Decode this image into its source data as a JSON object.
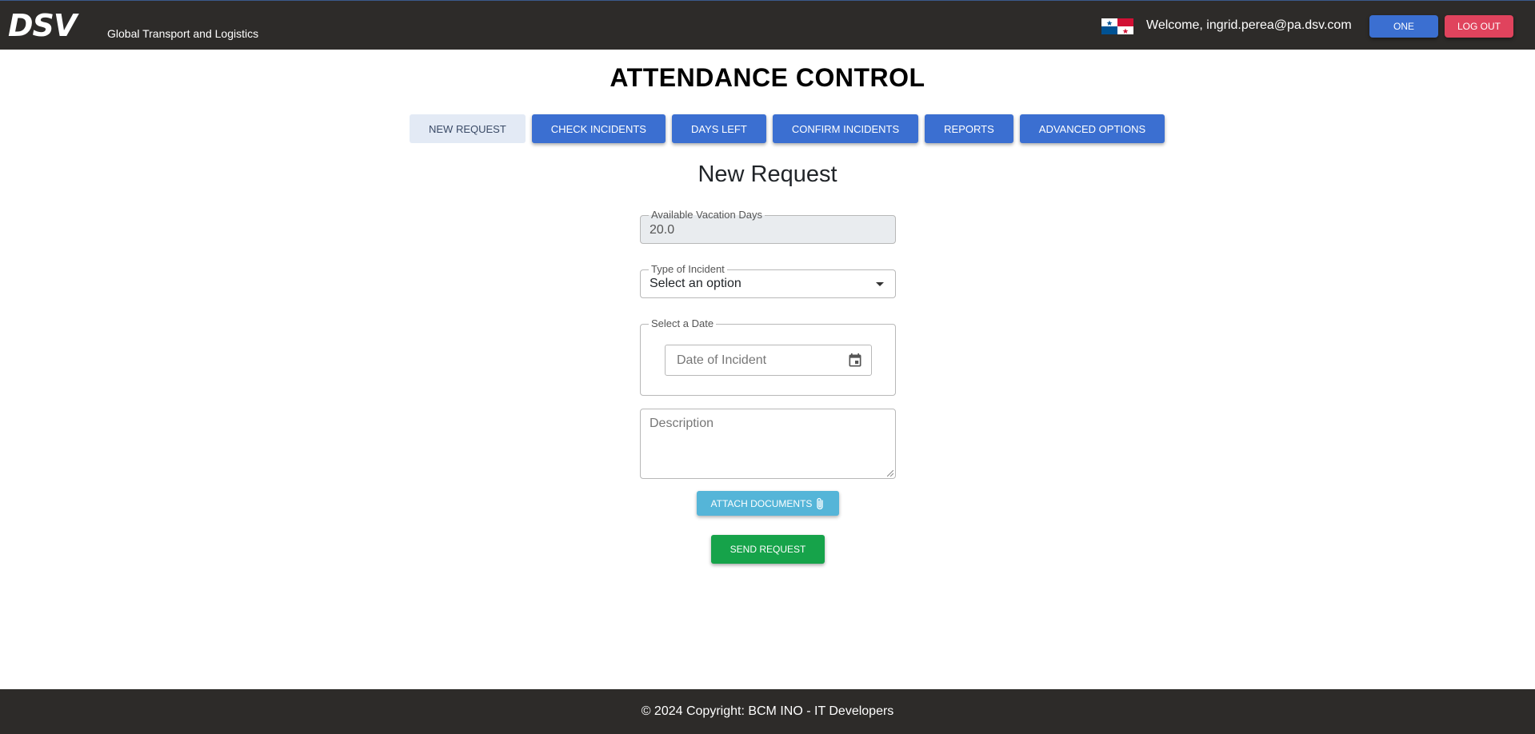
{
  "header": {
    "logo_text": "DSV",
    "tagline": "Global Transport and Logistics",
    "flag_icon": "panama-flag-icon",
    "welcome_text": "Welcome, ingrid.perea@pa.dsv.com",
    "one_label": "ONE",
    "logout_label": "LOG OUT"
  },
  "page_title": "ATTENDANCE CONTROL",
  "tabs": [
    {
      "label": "NEW REQUEST",
      "active": true
    },
    {
      "label": "CHECK INCIDENTS",
      "active": false
    },
    {
      "label": "DAYS LEFT",
      "active": false
    },
    {
      "label": "CONFIRM INCIDENTS",
      "active": false
    },
    {
      "label": "REPORTS",
      "active": false
    },
    {
      "label": "ADVANCED OPTIONS",
      "active": false
    }
  ],
  "form": {
    "heading": "New Request",
    "vacation_days": {
      "label": "Available Vacation Days",
      "value": "20.0"
    },
    "incident_type": {
      "label": "Type of Incident",
      "value": "Select an option"
    },
    "date": {
      "label": "Select a Date",
      "placeholder": "Date of Incident"
    },
    "description": {
      "placeholder": "Description"
    },
    "attach_label": "ATTACH DOCUMENTS",
    "send_label": "SEND REQUEST"
  },
  "footer": {
    "text": "© 2024 Copyright: BCM INO - IT Developers"
  },
  "colors": {
    "navbar": "#2d2b29",
    "primary": "#3b6fd1",
    "danger": "#e0435d",
    "info": "#55b5d8",
    "success": "#16a34a"
  }
}
